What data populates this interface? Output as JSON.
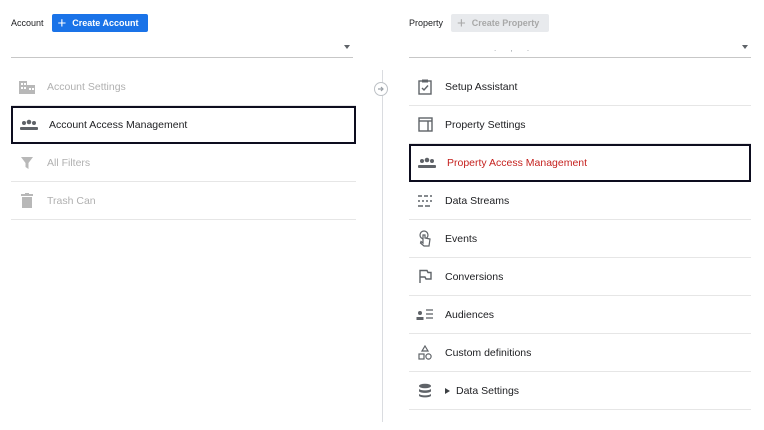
{
  "account": {
    "label": "Account",
    "create_label": "Create Account",
    "select_value": ""
  },
  "property": {
    "label": "Property",
    "create_label": "Create Property",
    "select_value": ". , ."
  },
  "account_items": [
    {
      "label": "Account Settings",
      "icon": "building-icon",
      "state": "disabled"
    },
    {
      "label": "Account Access Management",
      "icon": "people-icon",
      "state": "highlighted"
    },
    {
      "label": "All Filters",
      "icon": "filter-icon",
      "state": "disabled"
    },
    {
      "label": "Trash Can",
      "icon": "trash-icon",
      "state": "disabled"
    }
  ],
  "property_items": [
    {
      "label": "Setup Assistant",
      "icon": "checklist-icon"
    },
    {
      "label": "Property Settings",
      "icon": "layout-icon"
    },
    {
      "label": "Property Access Management",
      "icon": "people-icon",
      "state": "highlighted"
    },
    {
      "label": "Data Streams",
      "icon": "streams-icon"
    },
    {
      "label": "Events",
      "icon": "touch-icon"
    },
    {
      "label": "Conversions",
      "icon": "flag-icon"
    },
    {
      "label": "Audiences",
      "icon": "audience-icon"
    },
    {
      "label": "Custom definitions",
      "icon": "shapes-icon"
    },
    {
      "label": "Data Settings",
      "icon": "database-icon",
      "expandable": true
    }
  ],
  "colors": {
    "primary": "#1a73e8",
    "highlight_border": "#0d0d1f",
    "highlight_text": "#c5221f",
    "muted_text": "#b0b0b0",
    "icon": "#5f6368"
  }
}
